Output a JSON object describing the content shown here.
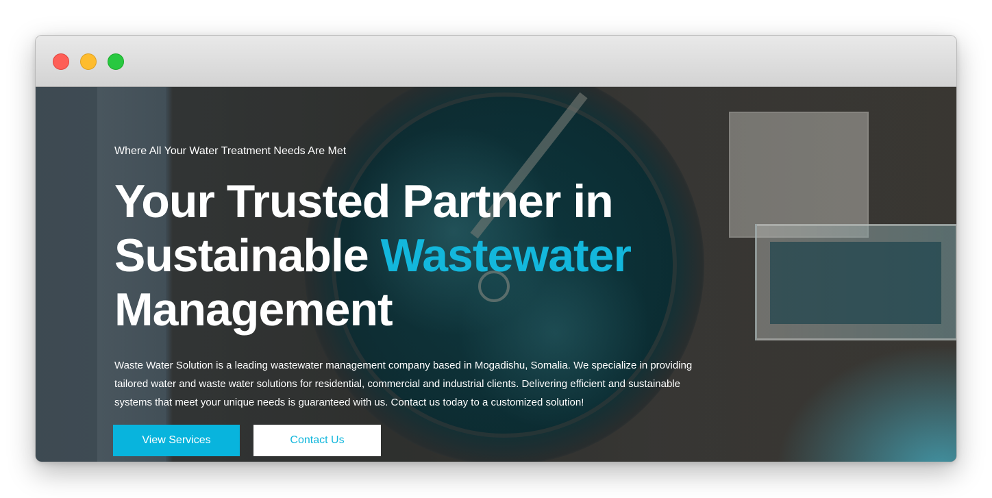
{
  "window": {
    "traffic_lights": [
      "close",
      "minimize",
      "maximize"
    ]
  },
  "hero": {
    "eyebrow": "Where All Your Water Treatment Needs Are Met",
    "headline_line1": "Your Trusted Partner in",
    "headline_line2_prefix": "Sustainable ",
    "headline_line2_accent": "Wastewater",
    "headline_line3": "Management",
    "description": "Waste Water Solution is a leading wastewater management company based in Mogadishu, Somalia. We specialize in providing tailored water and waste water solutions for residential, commercial and industrial clients. Delivering efficient and sustainable systems that meet your unique needs is guaranteed with us. Contact us today to a customized solution!",
    "primary_button": "View Services",
    "secondary_button": "Contact Us"
  },
  "colors": {
    "accent": "#13b7dc",
    "button_primary_bg": "#08b4dd",
    "text": "#ffffff"
  }
}
